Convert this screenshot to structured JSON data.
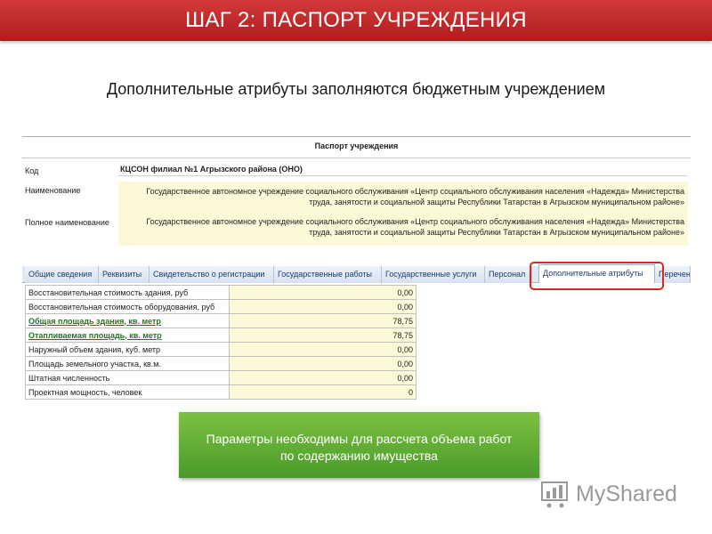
{
  "header": {
    "title": "ШАГ 2: ПАСПОРТ УЧРЕЖДЕНИЯ"
  },
  "subtitle": "Дополнительные атрибуты заполняются бюджетным учреждением",
  "passport": {
    "title": "Паспорт учреждения",
    "code_label": "Код",
    "code_value": "КЦСОН филиал №1 Агрызского района (ОНО)",
    "name_label": "Наименование",
    "name_line1": "Государственное автономное учреждение социального обслуживания «Центр социального обслуживания населения «Надежда» Министерства",
    "name_line2": "труда, занятости и социальной защиты Республики Татарстан в Агрызском муниципальном районе»",
    "fullname_label": "Полное наименование",
    "fullname_line1": "Государственное автономное учреждение социального обслуживания «Центр социального обслуживания населения «Надежда» Министерства",
    "fullname_line2": "труда, занятости и социальной защиты Республики Татарстан в Агрызском муниципальном районе»"
  },
  "tabs": [
    {
      "label": "Общие сведения"
    },
    {
      "label": "Реквизиты"
    },
    {
      "label": "Свидетельство о регистрации"
    },
    {
      "label": "Государственные работы"
    },
    {
      "label": "Государственные услуги"
    },
    {
      "label": "Персонал"
    },
    {
      "label": "Дополнительные атрибуты"
    },
    {
      "label": "Перечен"
    }
  ],
  "attributes": [
    {
      "label": "Восстановительная стоимость здания, руб",
      "value": "0,00"
    },
    {
      "label": "Восстановительная стоимость оборудования, руб",
      "value": "0,00"
    },
    {
      "label": "Общая площадь здания, кв. метр",
      "value": "78,75"
    },
    {
      "label": "Отапливаемая площадь, кв. метр",
      "value": "78,75"
    },
    {
      "label": "Наружный объем здания, куб. метр",
      "value": "0,00"
    },
    {
      "label": "Площадь земельного участка, кв.м.",
      "value": "0,00"
    },
    {
      "label": "Штатная численность",
      "value": "0,00"
    },
    {
      "label": "Проектная мощность, человек",
      "value": "0"
    }
  ],
  "note": {
    "line1": "Параметры необходимы для рассчета объема работ",
    "line2": "по содержанию имущества"
  },
  "logo": {
    "text": "MyShared",
    "icon": "chart-cart-icon"
  },
  "colors": {
    "header": "#c12a2a",
    "note": "#5ea934",
    "highlight": "#e02424",
    "input_bg": "#fdf8d8"
  }
}
